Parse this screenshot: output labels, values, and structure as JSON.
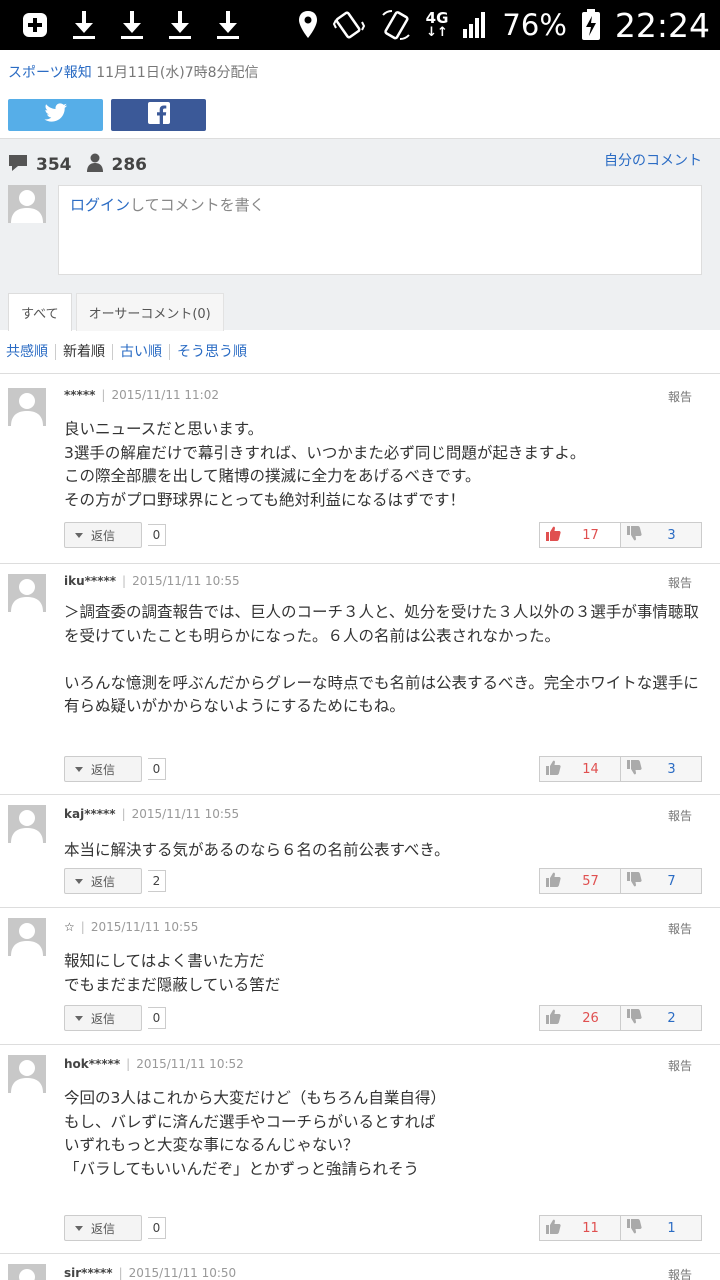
{
  "status_bar": {
    "battery_percent": "76%",
    "network": "4G",
    "time": "22:24",
    "icons": [
      "add-icon",
      "download-icon",
      "download-icon",
      "download-icon",
      "download-icon",
      "location-icon",
      "vibrate-icon",
      "rotate-icon",
      "4g-icon",
      "signal-icon",
      "battery-charging-icon"
    ]
  },
  "article": {
    "source_name": "スポーツ報知",
    "source_date": "11月11日(水)7時8分配信"
  },
  "share": {
    "twitter_icon": "twitter-icon",
    "facebook_icon": "facebook-icon"
  },
  "comment_panel": {
    "comment_count": "354",
    "user_count": "286",
    "my_comments_label": "自分のコメント",
    "login_link": "ログイン",
    "input_prompt": "してコメントを書く",
    "tabs": [
      {
        "label": "すべて"
      },
      {
        "label": "オーサーコメント(0)"
      }
    ]
  },
  "sort_options": [
    {
      "label": "共感順"
    },
    {
      "label": "新着順"
    },
    {
      "label": "古い順"
    },
    {
      "label": "そう思う順"
    }
  ],
  "comments": [
    {
      "user": "*****",
      "time": "2015/11/11 11:02",
      "report_label": "報告",
      "text": "良いニュースだと思います。\n3選手の解雇だけで幕引きすれば、いつかまた必ず同じ問題が起きますよ。\nこの際全部膿を出して賭博の撲滅に全力をあげるべきです。\nその方がプロ野球界にとっても絶対利益になるはずです！",
      "reply_label": "返信",
      "reply_count": "0",
      "likes": "17",
      "dislikes": "3"
    },
    {
      "user": "iku*****",
      "time": "2015/11/11 10:55",
      "report_label": "報告",
      "text": "＞調査委の調査報告では、巨人のコーチ３人と、処分を受けた３人以外の３選手が事情聴取を受けていたことも明らかになった。６人の名前は公表されなかった。\n\nいろんな憶測を呼ぶんだからグレーな時点でも名前は公表するべき。完全ホワイトな選手に有らぬ疑いがかからないようにするためにもね。",
      "reply_label": "返信",
      "reply_count": "0",
      "likes": "14",
      "dislikes": "3"
    },
    {
      "user": "kaj*****",
      "time": "2015/11/11 10:55",
      "report_label": "報告",
      "text": "本当に解決する気があるのなら６名の名前公表すべき。",
      "reply_label": "返信",
      "reply_count": "2",
      "likes": "57",
      "dislikes": "7"
    },
    {
      "user": "☆",
      "time": "2015/11/11 10:55",
      "report_label": "報告",
      "text": "報知にしてはよく書いた方だ\nでもまだまだ隠蔽している筈だ",
      "reply_label": "返信",
      "reply_count": "0",
      "likes": "26",
      "dislikes": "2"
    },
    {
      "user": "hok*****",
      "time": "2015/11/11 10:52",
      "report_label": "報告",
      "text": "今回の3人はこれから大変だけど（もちろん自業自得）\nもし、バレずに済んだ選手やコーチらがいるとすれば\nいずれもっと大変な事になるんじゃない？\n「バラしてもいいんだぞ」とかずっと強請られそう",
      "reply_label": "返信",
      "reply_count": "0",
      "likes": "11",
      "dislikes": "1"
    },
    {
      "user": "sir*****",
      "time": "2015/11/11 10:50",
      "report_label": "報告"
    }
  ]
}
